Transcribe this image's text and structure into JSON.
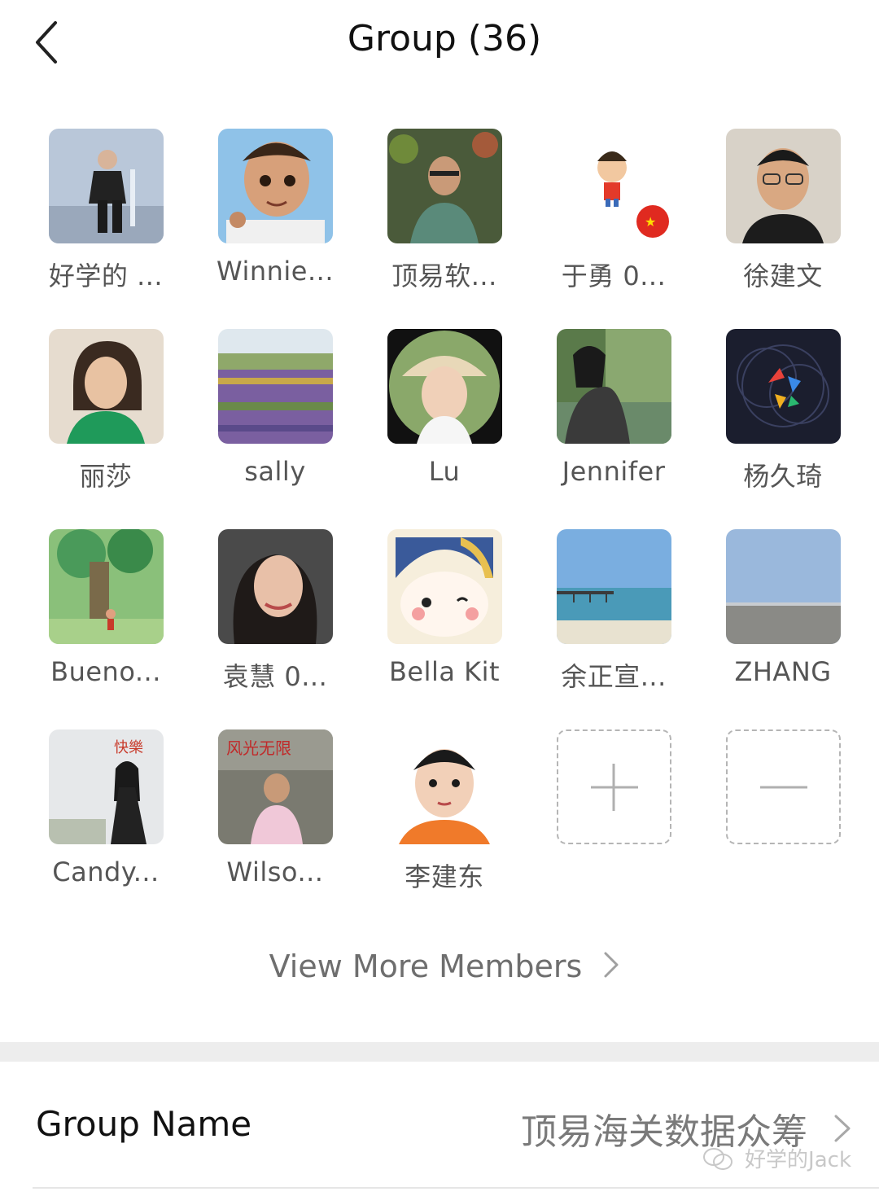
{
  "header": {
    "title": "Group (36)"
  },
  "members": [
    {
      "name": "好学的 ..."
    },
    {
      "name": "Winnie..."
    },
    {
      "name": "顶易软..."
    },
    {
      "name": "于勇 0..."
    },
    {
      "name": "徐建文"
    },
    {
      "name": "丽莎"
    },
    {
      "name": "sally"
    },
    {
      "name": "Lu"
    },
    {
      "name": "Jennifer"
    },
    {
      "name": "杨久琦"
    },
    {
      "name": "Bueno..."
    },
    {
      "name": "袁慧 0..."
    },
    {
      "name": "Bella Kit"
    },
    {
      "name": "余正宣..."
    },
    {
      "name": "ZHANG"
    },
    {
      "name": "Candy..."
    },
    {
      "name": "Wilso..."
    },
    {
      "name": "李建东"
    }
  ],
  "view_more": {
    "label": "View More Members"
  },
  "group_name_row": {
    "label": "Group Name",
    "value": "顶易海关数据众筹"
  },
  "watermark": {
    "text": "好学的Jack"
  }
}
